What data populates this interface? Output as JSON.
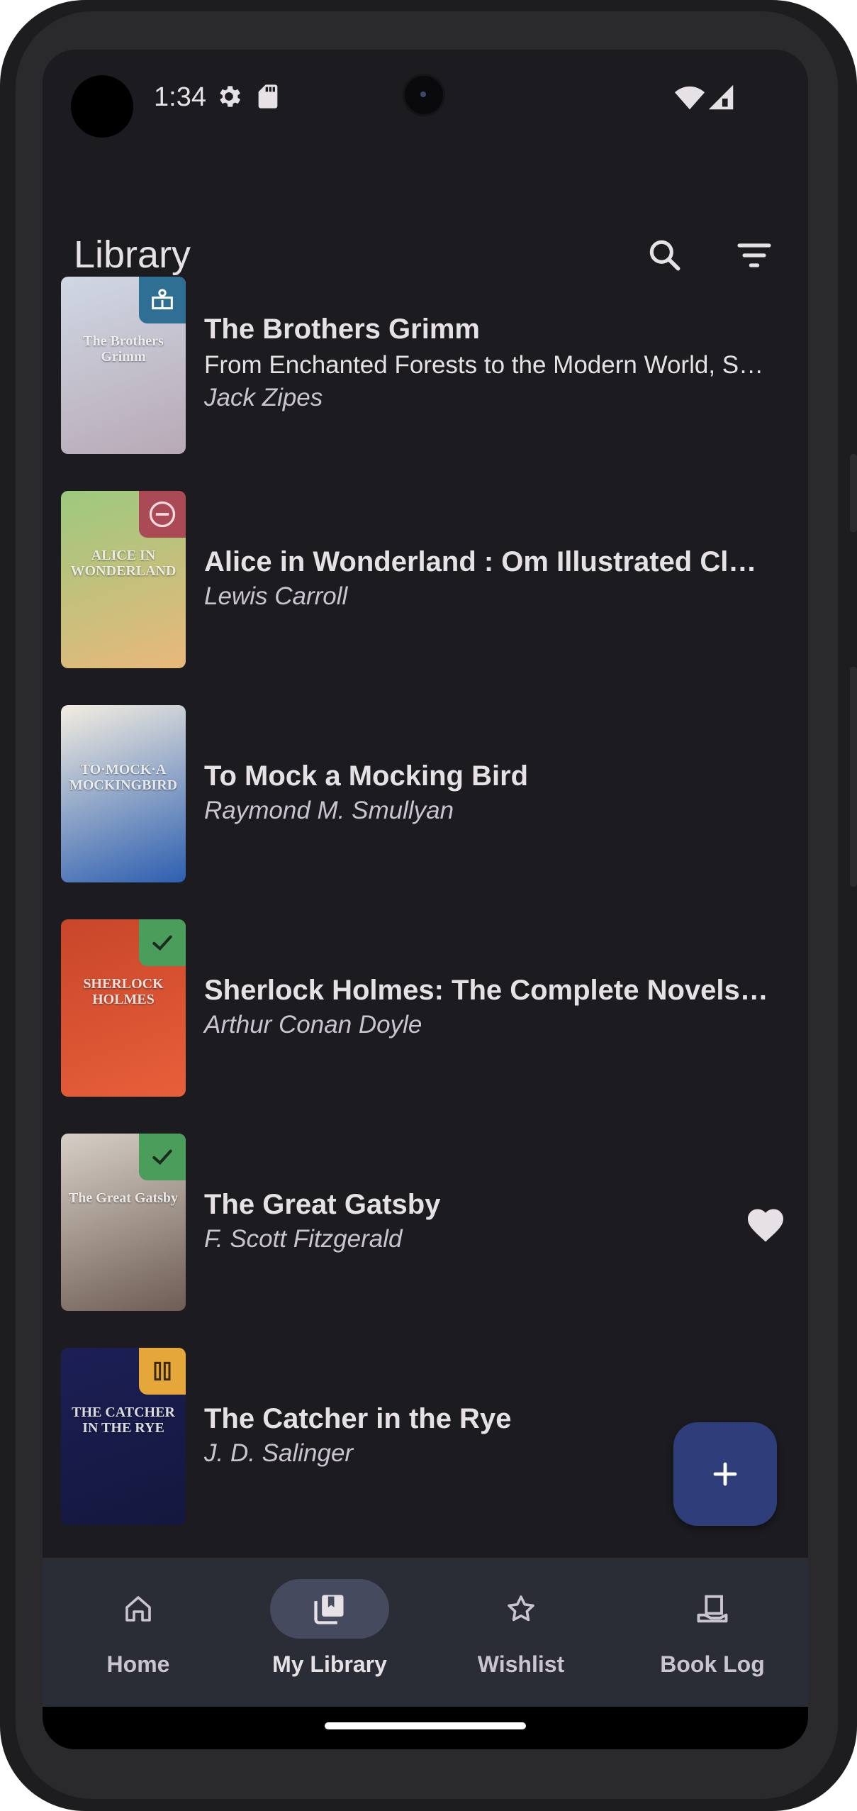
{
  "status_bar": {
    "time": "1:34"
  },
  "top_bar": {
    "title": "Library",
    "search_icon": "search-icon",
    "filter_icon": "filter-icon"
  },
  "books": [
    {
      "title": "The Brothers Grimm",
      "subtitle": "From Enchanted Forests to the Modern World, S…",
      "author": "Jack Zipes",
      "status": "reading",
      "status_color": "#2f6f94",
      "favorite": false,
      "cover_colors": [
        "#cfd8e4",
        "#b8a9b6"
      ],
      "cover_text": "The Brothers Grimm"
    },
    {
      "title": "Alice in Wonderland : Om Illustrated Clas…",
      "subtitle": "",
      "author": "Lewis Carroll",
      "status": "dropped",
      "status_color": "#a94a55",
      "favorite": false,
      "cover_colors": [
        "#9cc97e",
        "#e9b87b"
      ],
      "cover_text": "ALICE IN WONDERLAND"
    },
    {
      "title": "To Mock a Mocking Bird",
      "subtitle": "",
      "author": "Raymond M. Smullyan",
      "status": "none",
      "status_color": "",
      "favorite": false,
      "cover_colors": [
        "#f3ede0",
        "#2d5fb0"
      ],
      "cover_text": "TO·MOCK·A MOCKINGBIRD"
    },
    {
      "title": "Sherlock Holmes: The Complete Novels …",
      "subtitle": "",
      "author": "Arthur Conan Doyle",
      "status": "finished",
      "status_color": "#4a9d5a",
      "favorite": false,
      "cover_colors": [
        "#c8462a",
        "#e85f3a"
      ],
      "cover_text": "SHERLOCK HOLMES"
    },
    {
      "title": "The Great Gatsby",
      "subtitle": "",
      "author": "F. Scott Fitzgerald",
      "status": "finished",
      "status_color": "#4a9d5a",
      "favorite": true,
      "cover_colors": [
        "#d7cfc7",
        "#6e5d52"
      ],
      "cover_text": "The Great Gatsby"
    },
    {
      "title": "The Catcher in the Rye",
      "subtitle": "",
      "author": "J. D. Salinger",
      "status": "paused",
      "status_color": "#e6a73a",
      "favorite": false,
      "cover_colors": [
        "#1c1f55",
        "#14173d"
      ],
      "cover_text": "THE CATCHER IN THE RYE"
    }
  ],
  "fab": {
    "icon": "add-icon"
  },
  "nav": [
    {
      "label": "Home",
      "icon": "home-icon",
      "active": false
    },
    {
      "label": "My Library",
      "icon": "library-icon",
      "active": true
    },
    {
      "label": "Wishlist",
      "icon": "star-icon",
      "active": false
    },
    {
      "label": "Book Log",
      "icon": "book-log-icon",
      "active": false
    }
  ]
}
